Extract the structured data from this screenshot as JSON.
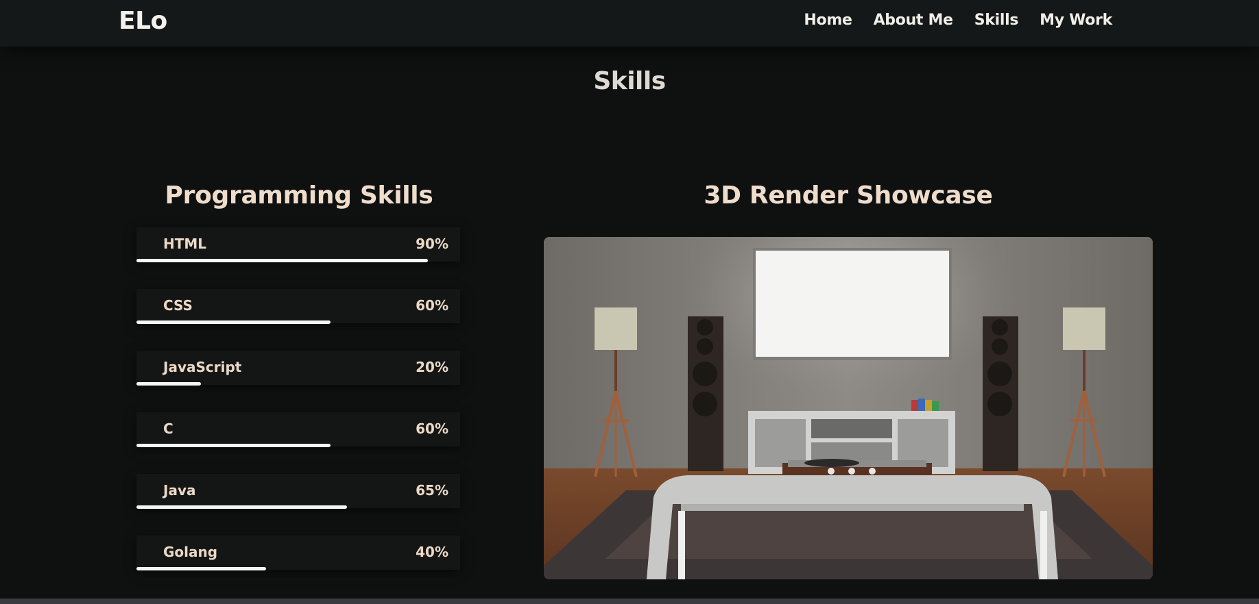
{
  "nav": {
    "logo": "ELo",
    "links": [
      "Home",
      "About Me",
      "Skills",
      "My Work"
    ]
  },
  "section": {
    "title": "Skills"
  },
  "programming": {
    "title": "Programming Skills",
    "skills": [
      {
        "name": "HTML",
        "percent_label": "90%",
        "level": 0.9
      },
      {
        "name": "CSS",
        "percent_label": "60%",
        "level": 0.6
      },
      {
        "name": "JavaScript",
        "percent_label": "20%",
        "level": 0.2
      },
      {
        "name": "C",
        "percent_label": "60%",
        "level": 0.6
      },
      {
        "name": "Java",
        "percent_label": "65%",
        "level": 0.65
      },
      {
        "name": "Golang",
        "percent_label": "40%",
        "level": 0.4
      }
    ]
  },
  "showcase": {
    "title": "3D Render Showcase",
    "slides": 3,
    "active_slide": 1
  },
  "colors": {
    "background": "#0f1111",
    "navbar": "#151818",
    "accent_text": "#efdccb",
    "bar_fill": "#f5f5f5"
  }
}
